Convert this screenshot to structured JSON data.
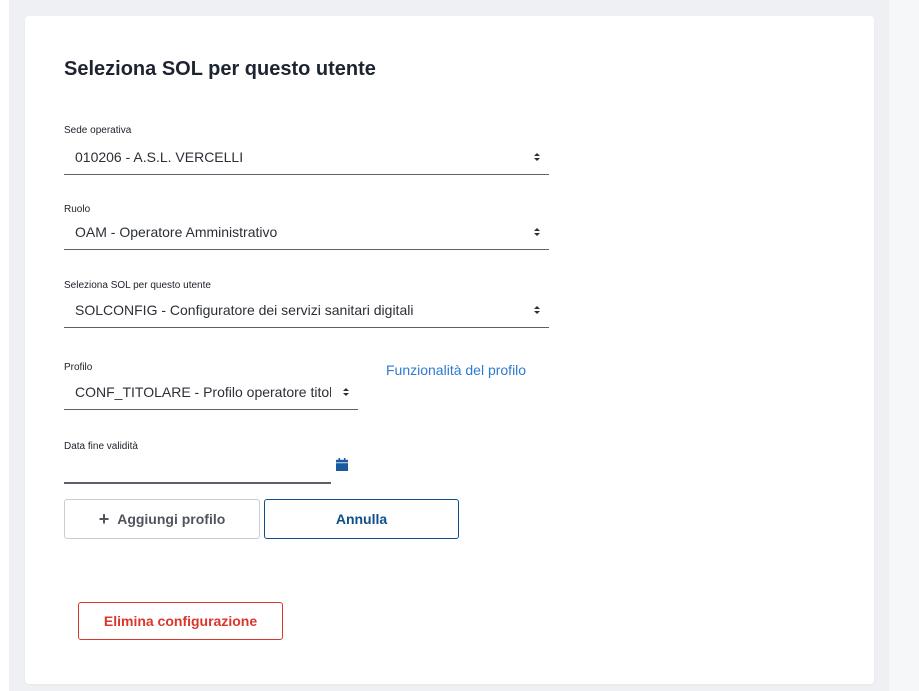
{
  "form": {
    "title": "Seleziona SOL per questo utente",
    "sede": {
      "label": "Sede operativa",
      "value": "010206 - A.S.L. VERCELLI"
    },
    "ruolo": {
      "label": "Ruolo",
      "value": "OAM - Operatore Amministrativo"
    },
    "sol": {
      "label": "Seleziona SOL per questo utente",
      "value": "SOLCONFIG - Configuratore dei servizi sanitari digitali"
    },
    "profilo": {
      "label": "Profilo",
      "value": "CONF_TITOLARE - Profilo operatore titolare"
    },
    "profile_link": "Funzionalità del profilo",
    "data_fine": {
      "label": "Data fine validità",
      "value": ""
    },
    "add_button": "Aggiungi profilo",
    "cancel_button": "Annulla",
    "delete_button": "Elimina configurazione"
  },
  "colors": {
    "link": "#2f7ad0",
    "primary": "#0e4e8a",
    "danger": "#d9362e",
    "calendar_icon": "#1b5aa0"
  },
  "icons": [
    "sort-caret-icon",
    "calendar-icon",
    "plus-icon"
  ]
}
